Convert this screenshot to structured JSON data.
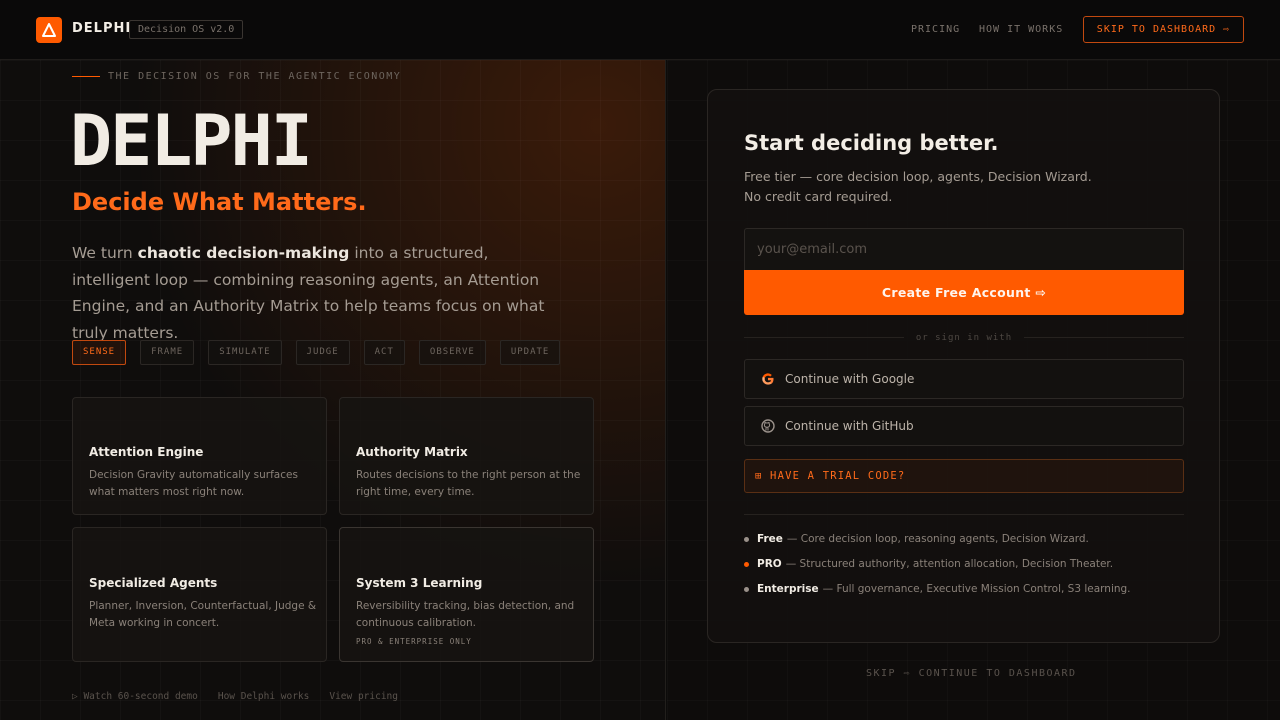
{
  "header": {
    "brand": "DELPHI",
    "version": "Decision OS v2.0",
    "nav": [
      "PRICING",
      "HOW IT WORKS"
    ],
    "skip_button": "SKIP TO DASHBOARD ⇨"
  },
  "hero": {
    "eyebrow": "THE DECISION OS FOR THE AGENTIC ECONOMY",
    "title": "DELPHI",
    "tagline": "Decide What Matters.",
    "desc_pre": "We turn ",
    "desc_bold": "chaotic decision-making",
    "desc_post": " into a structured, intelligent loop — combining reasoning agents, an Attention Engine, and an Authority Matrix to help teams focus on what truly matters."
  },
  "steps": [
    "SENSE",
    "FRAME",
    "SIMULATE",
    "JUDGE",
    "ACT",
    "OBSERVE",
    "UPDATE"
  ],
  "cards": [
    {
      "title": "Attention Engine",
      "desc": "Decision Gravity automatically surfaces what matters most right now."
    },
    {
      "title": "Authority Matrix",
      "desc": "Routes decisions to the right person at the right time, every time."
    },
    {
      "title": "Specialized Agents",
      "desc": "Planner, Inversion, Counterfactual, Judge & Meta working in concert."
    },
    {
      "title": "System 3 Learning",
      "desc": "Reversibility tracking, bias detection, and continuous calibration.",
      "badge": "PRO & ENTERPRISE ONLY"
    }
  ],
  "footer_links": [
    "▷ Watch 60-second demo",
    "How Delphi works",
    "View pricing"
  ],
  "signup": {
    "title": "Start deciding better.",
    "sub_line1": "Free tier — core decision loop, agents, Decision Wizard.",
    "sub_line2": "No credit card required.",
    "email_placeholder": "your@email.com",
    "create_button": "Create Free Account ⇨",
    "divider": "or sign in with",
    "google": "Continue with Google",
    "github": "Continue with GitHub",
    "trial": "⊞ HAVE A TRIAL CODE?",
    "tiers": [
      {
        "name": "Free",
        "desc": "— Core decision loop, reasoning agents, Decision Wizard."
      },
      {
        "name": "PRO",
        "desc": "— Structured authority, attention allocation, Decision Theater."
      },
      {
        "name": "Enterprise",
        "desc": "— Full governance, Executive Mission Control, S3 learning."
      }
    ]
  },
  "skip_bottom": "SKIP ⇨ CONTINUE TO DASHBOARD",
  "colors": {
    "accent": "#ff5a00",
    "background": "#0c0b0a"
  }
}
